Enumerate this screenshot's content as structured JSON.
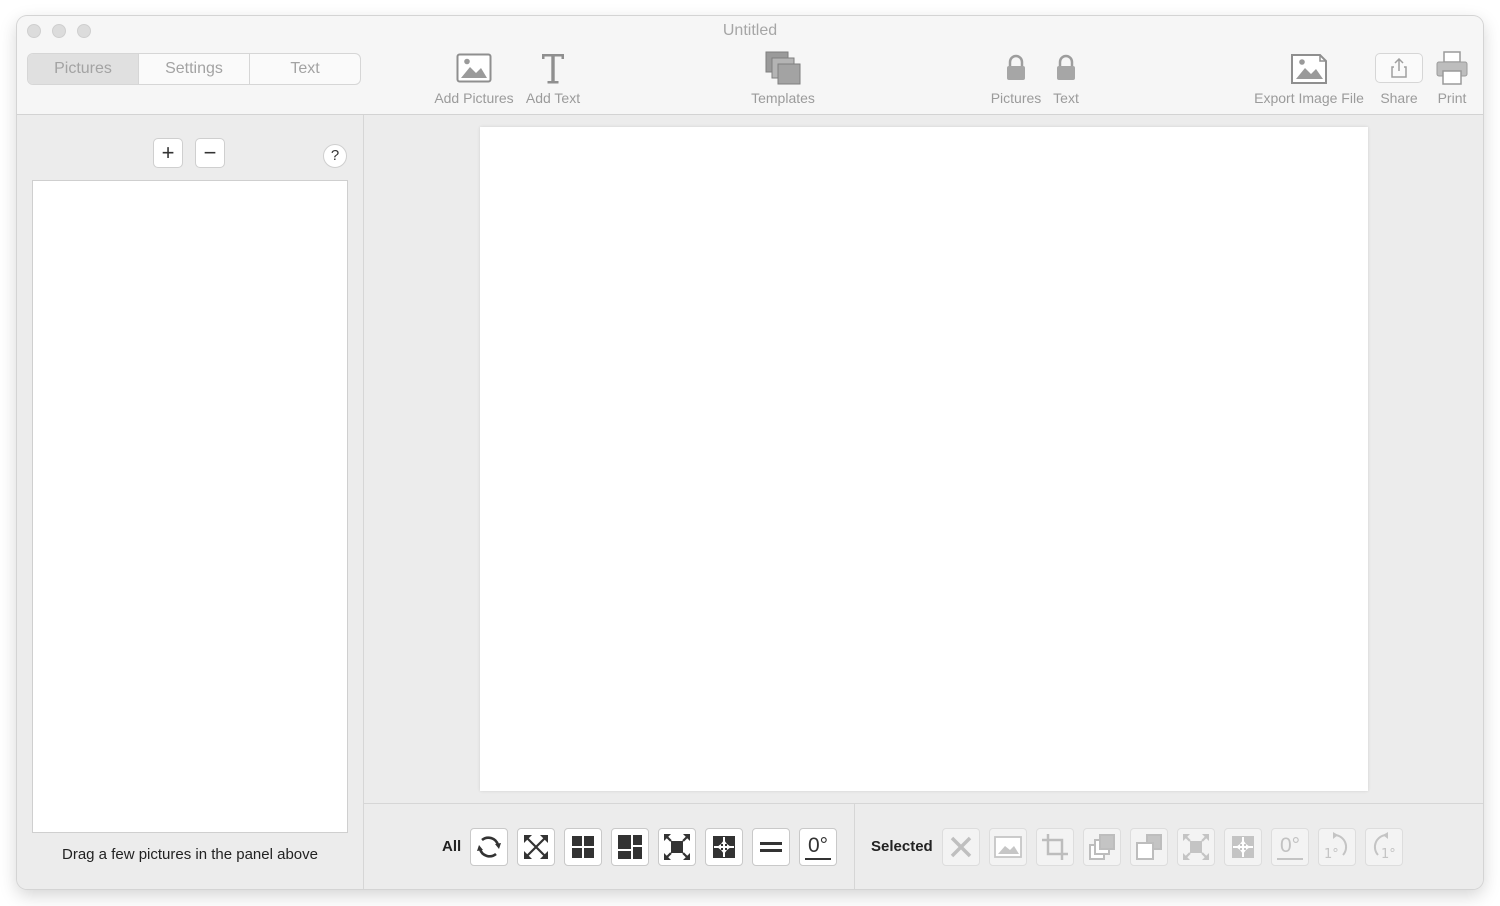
{
  "window": {
    "title": "Untitled"
  },
  "tabs": [
    {
      "label": "Pictures",
      "active": true
    },
    {
      "label": "Settings",
      "active": false
    },
    {
      "label": "Text",
      "active": false
    }
  ],
  "toolbar": {
    "add_pictures": "Add Pictures",
    "add_text": "Add Text",
    "templates": "Templates",
    "lock_pictures": "Pictures",
    "lock_text": "Text",
    "export": "Export Image File",
    "share": "Share",
    "print": "Print"
  },
  "sidebar": {
    "add_symbol": "+",
    "remove_symbol": "−",
    "help_symbol": "?",
    "hint": "Drag a few pictures in the panel above"
  },
  "bottom": {
    "all_label": "All",
    "selected_label": "Selected",
    "all_buttons": [
      {
        "name": "rotate-all-icon"
      },
      {
        "name": "expand-all-icon"
      },
      {
        "name": "grid-layout-icon"
      },
      {
        "name": "mosaic-layout-icon"
      },
      {
        "name": "fit-all-icon"
      },
      {
        "name": "center-all-icon"
      },
      {
        "name": "equal-spacing-icon"
      },
      {
        "name": "reset-rotation-all-icon",
        "text": "0°"
      }
    ],
    "selected_buttons": [
      {
        "name": "delete-icon"
      },
      {
        "name": "replace-image-icon"
      },
      {
        "name": "crop-icon"
      },
      {
        "name": "bring-forward-icon"
      },
      {
        "name": "send-backward-icon"
      },
      {
        "name": "fit-selected-icon"
      },
      {
        "name": "center-selected-icon"
      },
      {
        "name": "reset-rotation-selected-icon",
        "text": "0°"
      },
      {
        "name": "rotate-right-icon",
        "text": "1°"
      },
      {
        "name": "rotate-left-icon",
        "text": "1°"
      }
    ]
  },
  "colors": {
    "window_bg": "#ececec",
    "toolbar_bg": "#f6f6f6",
    "canvas_bg": "#ffffff",
    "disabled_text": "#9b9b9b"
  }
}
